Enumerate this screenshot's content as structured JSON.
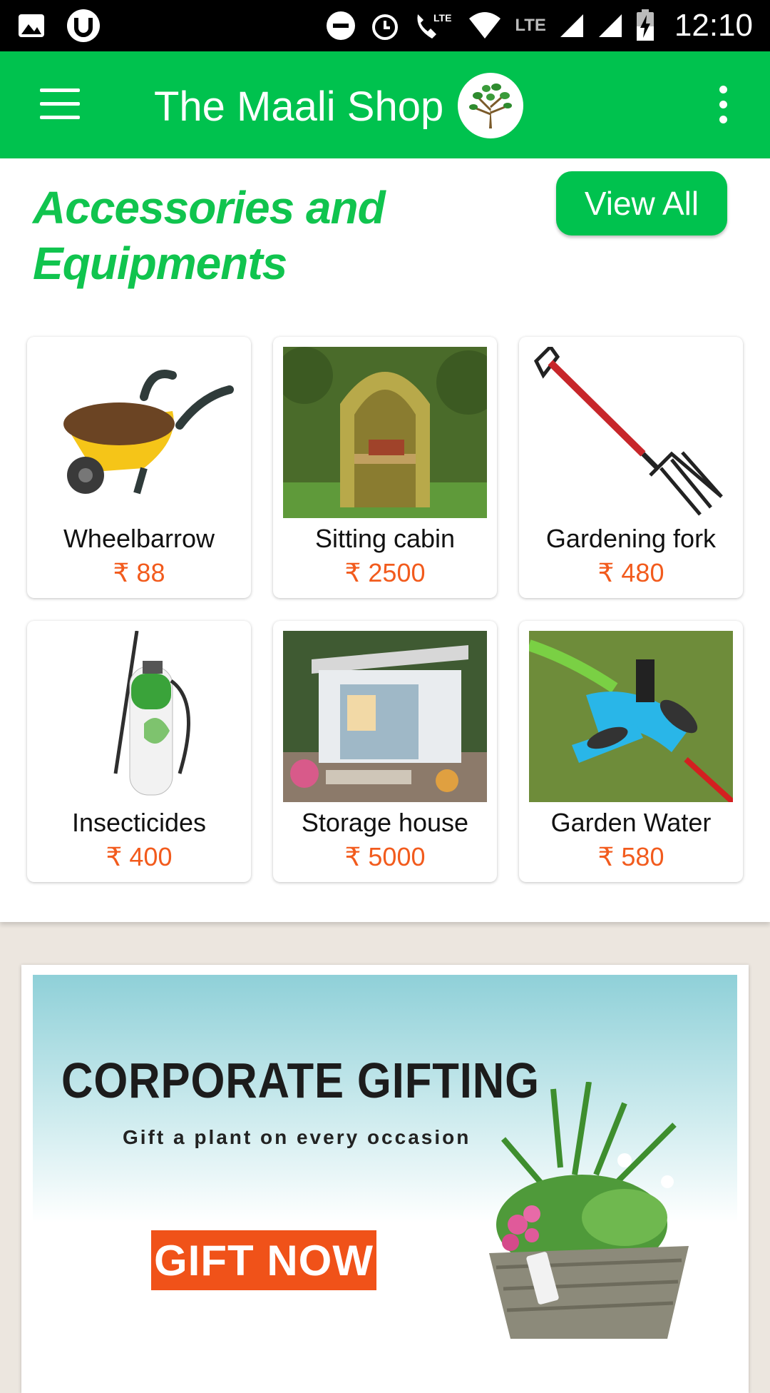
{
  "status_bar": {
    "time": "12:10",
    "network_label": "LTE",
    "icons": [
      "image-icon",
      "utorrent-icon",
      "do-not-disturb-icon",
      "alarm-icon",
      "volte-call-icon",
      "wifi-icon",
      "signal-icon",
      "signal-icon",
      "battery-charging-icon"
    ]
  },
  "app_bar": {
    "title": "The Maali Shop",
    "icons": [
      "menu-icon",
      "tree-logo-icon",
      "more-vert-icon"
    ],
    "accent_color": "#00c24e"
  },
  "section": {
    "title_line1": "Accessories and",
    "title_line2": "Equipments",
    "view_all_label": "View All"
  },
  "products": [
    {
      "name": "Wheelbarrow",
      "price": "₹ 88"
    },
    {
      "name": "Sitting cabin",
      "price": "₹ 2500"
    },
    {
      "name": "Gardening fork",
      "price": "₹ 480"
    },
    {
      "name": "Insecticides",
      "price": "₹ 400"
    },
    {
      "name": "Storage house",
      "price": "₹ 5000"
    },
    {
      "name": "Garden Water",
      "price": "₹ 580"
    }
  ],
  "price_color": "#f25b1d",
  "banner": {
    "title": "CORPORATE GIFTING",
    "subtitle": "Gift a plant on every occasion",
    "button_label": "GIFT NOW"
  }
}
